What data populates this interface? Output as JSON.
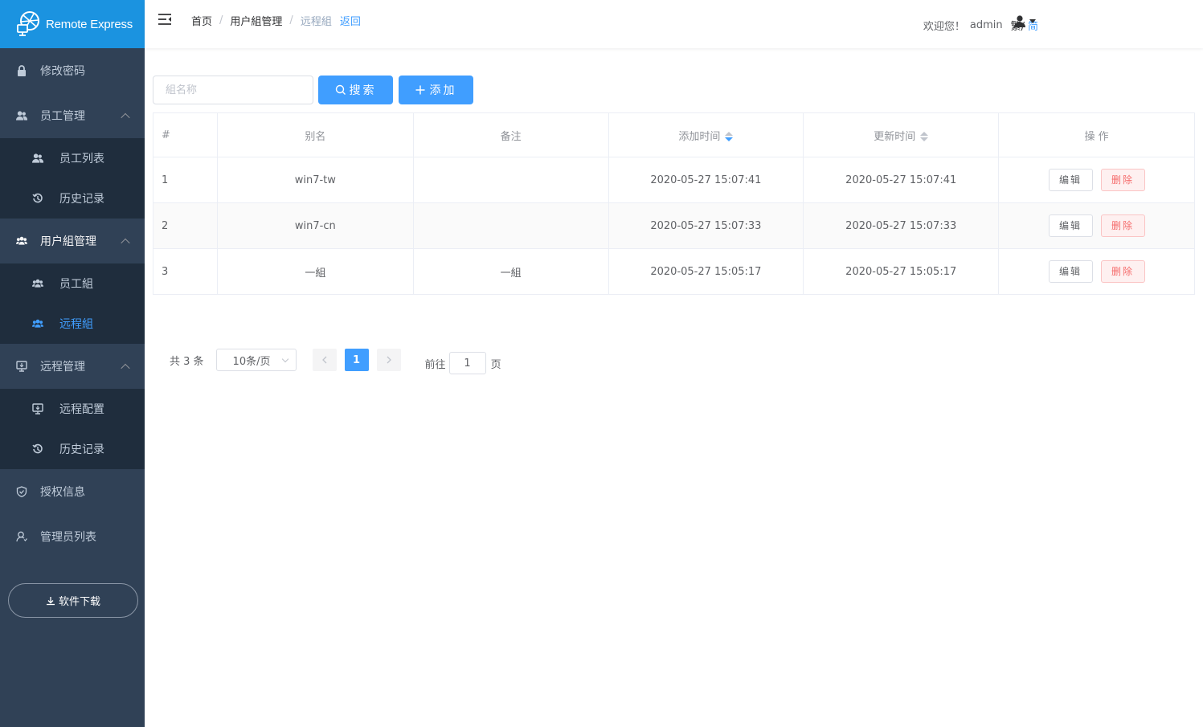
{
  "app": {
    "logo_text": "Remote Express"
  },
  "sidebar": {
    "change_password": "修改密码",
    "staff_mgmt": "员工管理",
    "staff_list": "员工列表",
    "staff_history": "历史记录",
    "group_mgmt": "用户組管理",
    "staff_group": "员工組",
    "remote_group": "远程組",
    "remote_mgmt": "远程管理",
    "remote_config": "远程配置",
    "remote_history": "历史记录",
    "license_info": "授权信息",
    "admin_list": "管理员列表",
    "download": "软件下载"
  },
  "header": {
    "breadcrumb": [
      "首页",
      "用户組管理",
      "远程組"
    ],
    "back": "返回",
    "welcome": "欢迎您！",
    "username": "admin",
    "traditional": "繁/",
    "simplified": "简"
  },
  "toolbar": {
    "search_placeholder": "組名称",
    "search_label": "搜索",
    "add_label": "添加"
  },
  "table": {
    "headers": [
      "#",
      "别名",
      "备注",
      "添加时间",
      "更新时间",
      "操 作"
    ],
    "edit_label": "编辑",
    "delete_label": "删除",
    "rows": [
      {
        "id": "1",
        "alias": "win7-tw",
        "note": "",
        "created": "2020-05-27 15:07:41",
        "updated": "2020-05-27 15:07:41"
      },
      {
        "id": "2",
        "alias": "win7-cn",
        "note": "",
        "created": "2020-05-27 15:07:33",
        "updated": "2020-05-27 15:07:33"
      },
      {
        "id": "3",
        "alias": "一組",
        "note": "一組",
        "created": "2020-05-27 15:05:17",
        "updated": "2020-05-27 15:05:17"
      }
    ]
  },
  "pagination": {
    "total": "共 3 条",
    "page_size": "10条/页",
    "current_page": "1",
    "goto_prefix": "前往",
    "goto_value": "1",
    "goto_suffix": "页"
  },
  "colors": {
    "sidebar": "#304156",
    "submenu": "#1f2d3d",
    "logo": "#1b93e0",
    "primary": "#409eff",
    "danger": "#f56c6c"
  }
}
